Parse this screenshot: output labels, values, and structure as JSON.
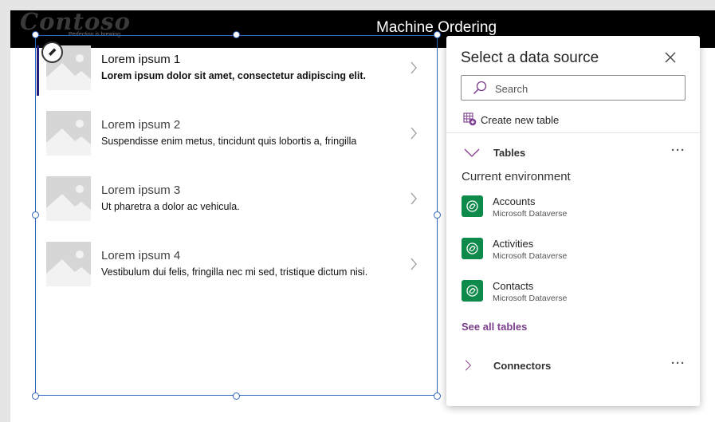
{
  "header": {
    "logo_text": "Contoso",
    "logo_tagline": "Perfection is brewing.",
    "title": "Machine Ordering"
  },
  "gallery": {
    "items": [
      {
        "title": "Lorem ipsum 1",
        "subtitle": "Lorem ipsum dolor sit amet, consectetur adipiscing elit.",
        "selected": true
      },
      {
        "title": "Lorem ipsum 2",
        "subtitle": "Suspendisse enim metus, tincidunt quis lobortis a, fringilla",
        "selected": false
      },
      {
        "title": "Lorem ipsum 3",
        "subtitle": "Ut pharetra a dolor ac vehicula.",
        "selected": false
      },
      {
        "title": "Lorem ipsum 4",
        "subtitle": "Vestibulum dui felis, fringilla nec mi sed, tristique dictum nisi.",
        "selected": false
      }
    ]
  },
  "panel": {
    "title": "Select a data source",
    "search_placeholder": "Search",
    "create_new_table": "Create new table",
    "tables_label": "Tables",
    "more_glyph": "···",
    "environment_label": "Current environment",
    "tables": [
      {
        "name": "Accounts",
        "source": "Microsoft Dataverse"
      },
      {
        "name": "Activities",
        "source": "Microsoft Dataverse"
      },
      {
        "name": "Contacts",
        "source": "Microsoft Dataverse"
      }
    ],
    "see_all_tables": "See all tables",
    "connectors_label": "Connectors"
  },
  "colors": {
    "header_bg": "#000000",
    "selection": "#2f63c0",
    "accent_bar": "#1e1e7a",
    "dataverse_green": "#0e8a4a",
    "link_purple": "#7a3e8c",
    "chevron_purple": "#8b3a8f"
  }
}
